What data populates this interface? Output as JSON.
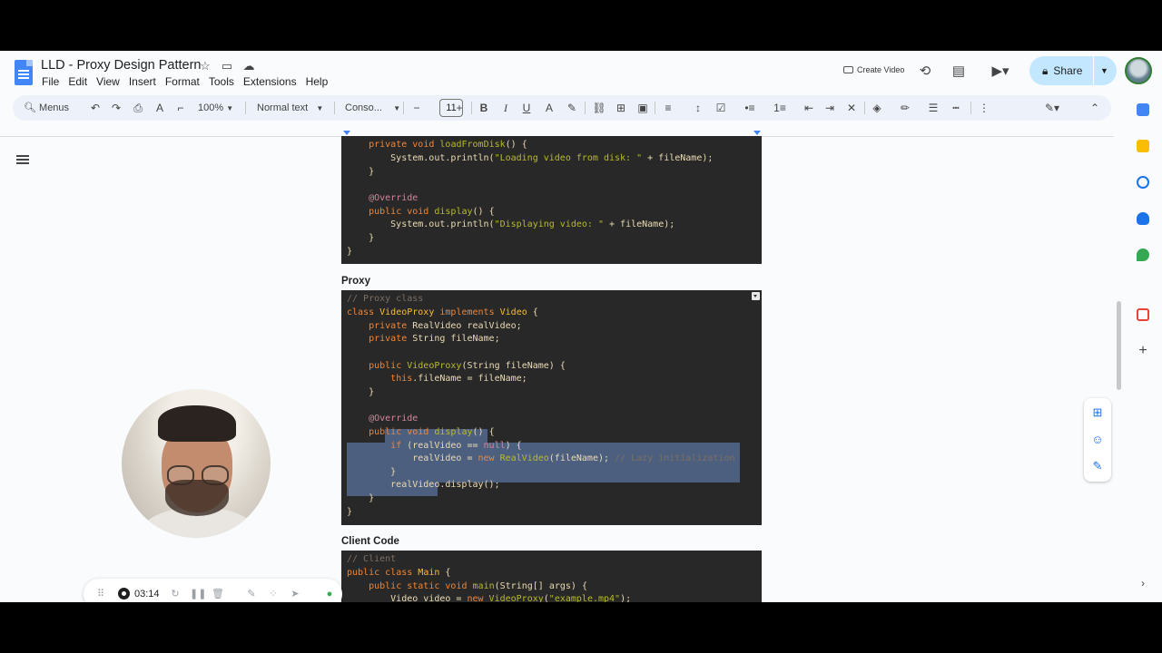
{
  "app": {
    "doc_title": "LLD - Proxy Design Pattern",
    "menu": [
      "File",
      "Edit",
      "View",
      "Insert",
      "Format",
      "Tools",
      "Extensions",
      "Help"
    ],
    "create_video_label": "Create Video",
    "share_label": "Share"
  },
  "toolbar": {
    "menus_label": "Menus",
    "zoom": "100%",
    "style": "Normal text",
    "font": "Conso...",
    "font_size": "11"
  },
  "document": {
    "block1": [
      "    private void loadFromDisk() {",
      "        System.out.println(\"Loading video from disk: \" + fileName);",
      "    }",
      "",
      "    @Override",
      "    public void display() {",
      "        System.out.println(\"Displaying video: \" + fileName);",
      "    }",
      "}"
    ],
    "heading_proxy": "Proxy",
    "block2": [
      "// Proxy class",
      "class VideoProxy implements Video {",
      "    private RealVideo realVideo;",
      "    private String fileName;",
      "",
      "    public VideoProxy(String fileName) {",
      "        this.fileName = fileName;",
      "    }",
      "",
      "    @Override",
      "    public void display() {",
      "        if (realVideo == null) {",
      "            realVideo = new RealVideo(fileName); // Lazy initialization",
      "        }",
      "        realVideo.display();",
      "    }",
      "}"
    ],
    "heading_client": "Client Code",
    "block3": [
      "// Client",
      "public class Main {",
      "    public static void main(String[] args) {",
      "        Video video = new VideoProxy(\"example.mp4\");"
    ]
  },
  "recorder": {
    "time": "03:14"
  },
  "colors": {
    "accent": "#1a73e8",
    "share_bg": "#c2e7ff",
    "code_bg": "#282828",
    "selection": "#6b8cc7"
  }
}
